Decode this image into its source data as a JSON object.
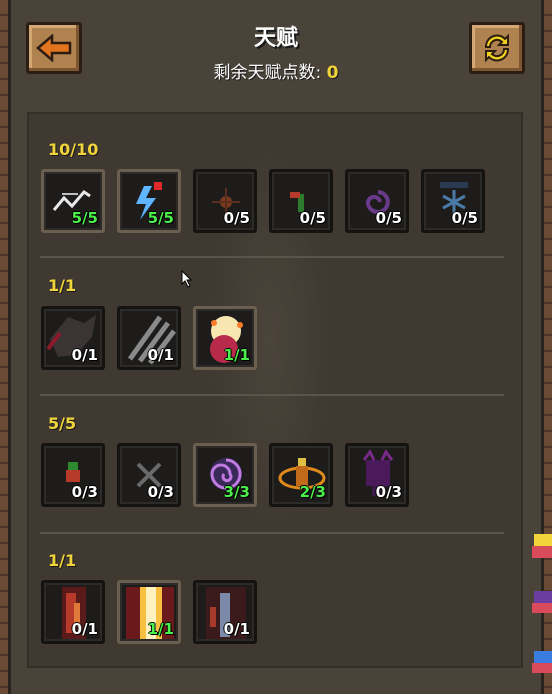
{
  "header": {
    "title": "天赋",
    "points_label": "剩余天赋点数: ",
    "points_value": "0",
    "back_icon": "arrow-left-icon",
    "refresh_icon": "refresh-icon"
  },
  "colors": {
    "label_yellow": "#f0d43a",
    "level_green": "#4cf04a",
    "panel_bg": "#3f3931"
  },
  "groups": [
    {
      "label": "10/10",
      "talents": [
        {
          "icon": "chain-bolt-icon",
          "level": "5/5",
          "maxed": true
        },
        {
          "icon": "lightning-arrow-icon",
          "level": "5/5",
          "maxed": true
        },
        {
          "icon": "burst-icon",
          "level": "0/5",
          "maxed": false
        },
        {
          "icon": "sprout-icon",
          "level": "0/5",
          "maxed": false
        },
        {
          "icon": "swirl-icon",
          "level": "0/5",
          "maxed": false
        },
        {
          "icon": "frost-icon",
          "level": "0/5",
          "maxed": false
        }
      ]
    },
    {
      "label": "1/1",
      "talents": [
        {
          "icon": "wolf-icon",
          "level": "0/1",
          "maxed": false
        },
        {
          "icon": "claw-slash-icon",
          "level": "0/1",
          "maxed": false
        },
        {
          "icon": "explosion-icon",
          "level": "1/1",
          "maxed": true
        }
      ]
    },
    {
      "label": "5/5",
      "talents": [
        {
          "icon": "figure-icon",
          "level": "0/3",
          "maxed": false
        },
        {
          "icon": "crossed-blades-icon",
          "level": "0/3",
          "maxed": false
        },
        {
          "icon": "vortex-icon",
          "level": "3/3",
          "maxed": true
        },
        {
          "icon": "orbit-figure-icon",
          "level": "2/3",
          "maxed": false
        },
        {
          "icon": "dark-spirit-icon",
          "level": "0/3",
          "maxed": false
        }
      ]
    },
    {
      "label": "1/1",
      "talents": [
        {
          "icon": "fire-pillar-icon",
          "level": "0/1",
          "maxed": false
        },
        {
          "icon": "holy-beam-icon",
          "level": "1/1",
          "maxed": true
        },
        {
          "icon": "crystal-pillar-icon",
          "level": "0/1",
          "maxed": false
        }
      ]
    }
  ]
}
